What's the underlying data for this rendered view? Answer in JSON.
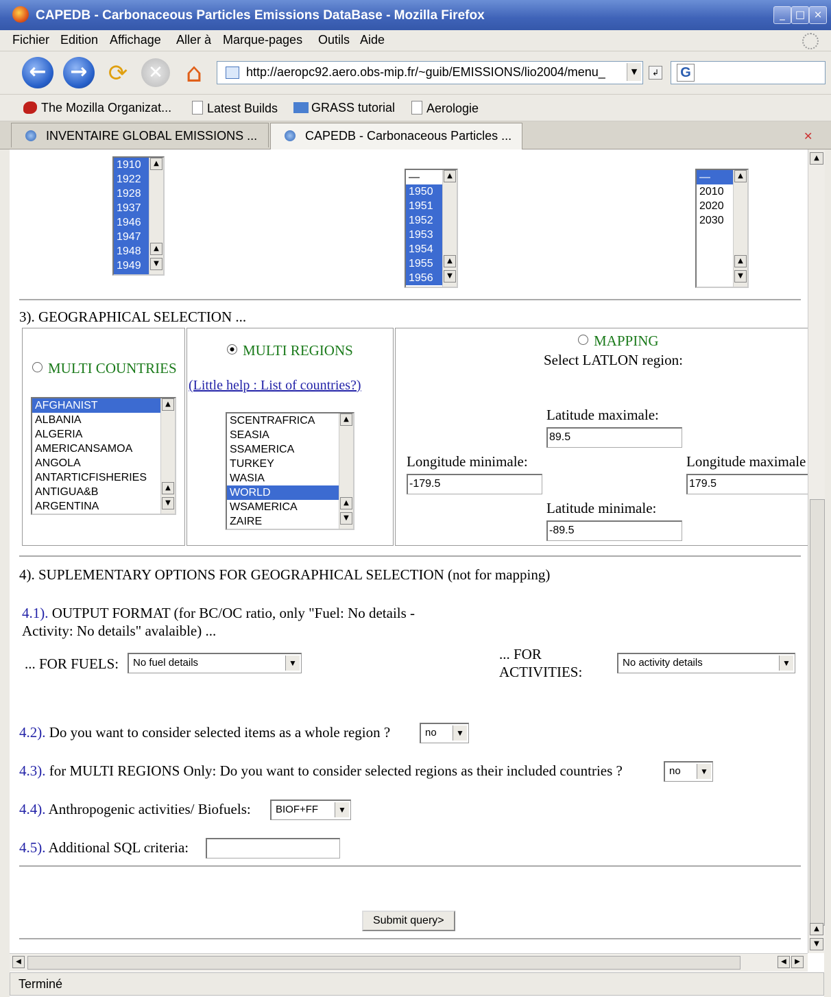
{
  "window": {
    "title": "CAPEDB - Carbonaceous Particles Emissions DataBase - Mozilla Firefox"
  },
  "menu": [
    "Fichier",
    "Edition",
    "Affichage",
    "Aller à",
    "Marque-pages",
    "Outils",
    "Aide"
  ],
  "navbar": {
    "url": "http://aeropc92.aero.obs-mip.fr/~guib/EMISSIONS/lio2004/menu_",
    "search_glyph": "G"
  },
  "bookmarks": [
    "The Mozilla Organizat...",
    "Latest Builds",
    "GRASS tutorial",
    "Aerologie"
  ],
  "tabs": [
    {
      "label": "INVENTAIRE GLOBAL EMISSIONS ...",
      "active": false
    },
    {
      "label": "CAPEDB - Carbonaceous Particles ...",
      "active": true
    }
  ],
  "year_lists": {
    "list1": [
      "1910",
      "1922",
      "1928",
      "1937",
      "1946",
      "1947",
      "1948",
      "1949"
    ],
    "list2": [
      "—",
      "1950",
      "1951",
      "1952",
      "1953",
      "1954",
      "1955",
      "1956"
    ],
    "list3": [
      "—",
      "2010",
      "2020",
      "2030"
    ]
  },
  "section3": {
    "title": "3). GEOGRAPHICAL SELECTION ...",
    "multi_countries": {
      "label": "MULTI COUNTRIES",
      "options": [
        "AFGHANIST",
        "ALBANIA",
        "ALGERIA",
        "AMERICANSAMOA",
        "ANGOLA",
        "ANTARTICFISHERIES",
        "ANTIGUA&B",
        "ARGENTINA"
      ],
      "selected": "AFGHANIST"
    },
    "multi_regions": {
      "label": "MULTI REGIONS",
      "help_link": "(Little help : List of countries?)",
      "options": [
        "SCENTRAFRICA",
        "SEASIA",
        "SSAMERICA",
        "TURKEY",
        "WASIA",
        "WORLD",
        "WSAMERICA",
        "ZAIRE"
      ],
      "selected": "WORLD"
    },
    "mapping": {
      "label": "MAPPING",
      "subtitle": "Select LATLON region:",
      "lat_max_label": "Latitude maximale:",
      "lat_max": "89.5",
      "lon_min_label": "Longitude minimale:",
      "lon_min": "-179.5",
      "lon_max_label": "Longitude maximale",
      "lon_max": "179.5",
      "lat_min_label": "Latitude minimale:",
      "lat_min": "-89.5"
    }
  },
  "section4": {
    "title": "4). SUPLEMENTARY OPTIONS FOR GEOGRAPHICAL SELECTION (not for mapping)",
    "s41_num": "4.1).",
    "s41_text_a": " OUTPUT FORMAT (for BC/OC ratio, only \"Fuel: No details -",
    "s41_text_b": "Activity: No details\" avalaible) ...",
    "fuels_label": "... FOR FUELS:",
    "fuels_value": "No fuel details",
    "activities_label_a": "... FOR",
    "activities_label_b": "ACTIVITIES:",
    "activities_value": "No activity details",
    "s42_num": "4.2).",
    "s42_text": " Do you want to consider selected items as a whole region ?",
    "s42_value": "no",
    "s43_num": "4.3).",
    "s43_text": " for MULTI REGIONS Only: Do you want to consider selected regions as their included countries ?",
    "s43_value": "no",
    "s44_num": "4.4).",
    "s44_text": " Anthropogenic activities/ Biofuels:",
    "s44_value": "BIOF+FF",
    "s45_num": "4.5).",
    "s45_text": " Additional SQL criteria:",
    "s45_value": ""
  },
  "submit_label": "Submit query>",
  "status": "Terminé",
  "colors": {
    "titlebar": "#3f63b8",
    "link_blue": "#2323a8",
    "selection": "#3c6bd1"
  }
}
